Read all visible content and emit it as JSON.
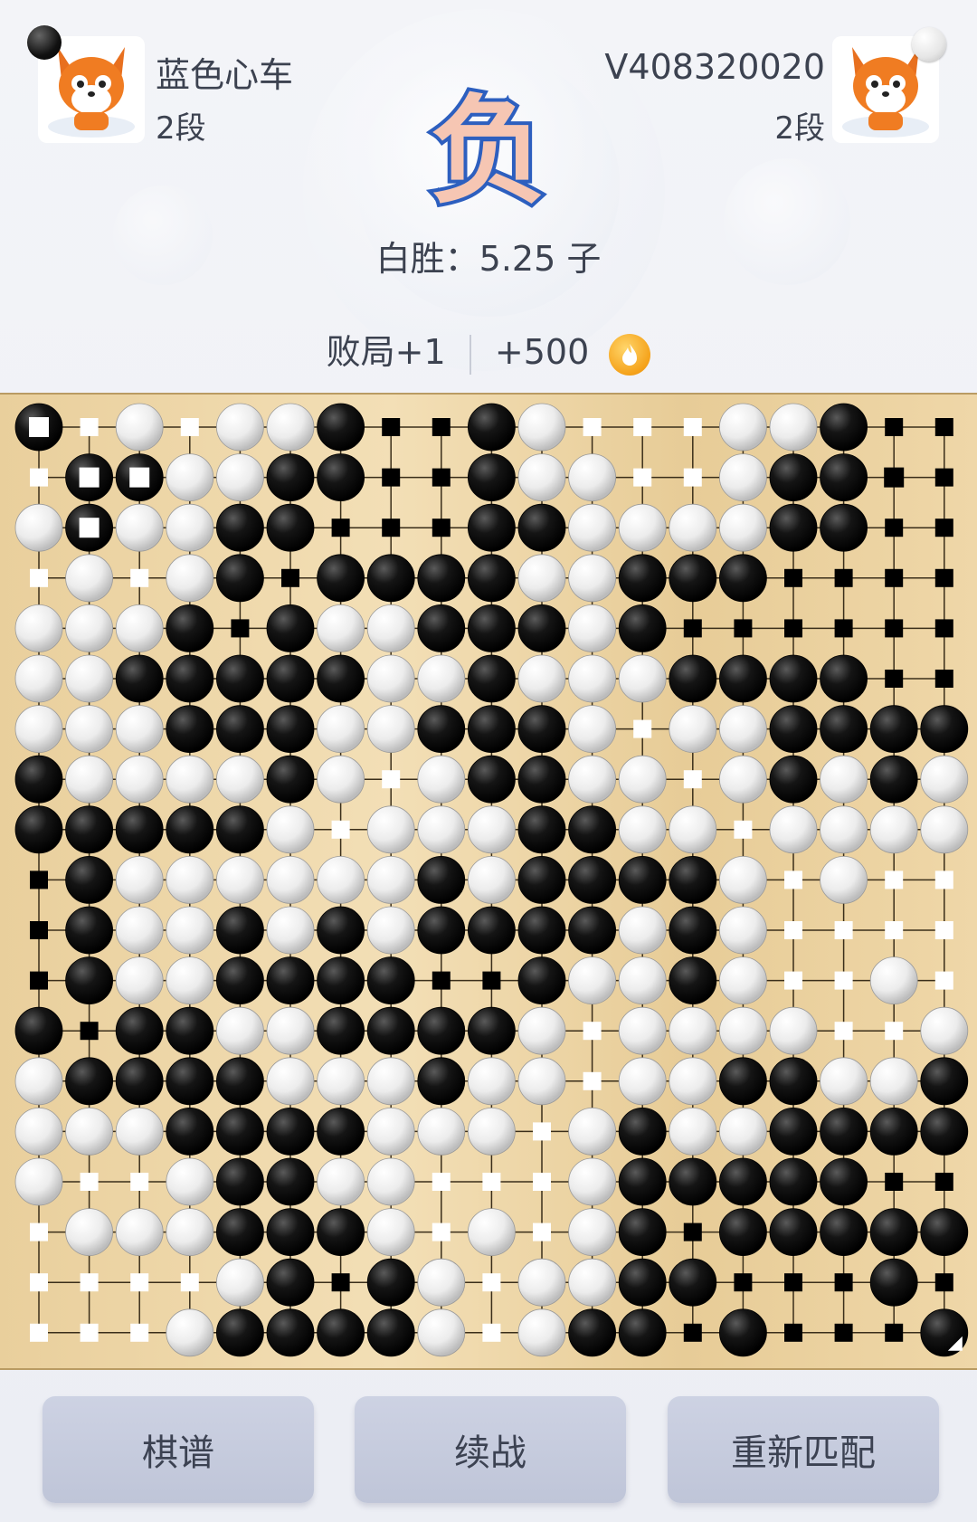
{
  "black_player": {
    "name": "蓝色心车",
    "rank": "2段",
    "stone": "black"
  },
  "white_player": {
    "name": "V408320020",
    "rank": "2段",
    "stone": "white"
  },
  "result": {
    "glyph": "负",
    "text": "白胜：5.25 子",
    "loss_count": "败局+1",
    "reward": "+500",
    "coin_icon": "coin-icon"
  },
  "board": {
    "size": 19,
    "legend": "B=black stone, W=white stone, b=black territory marker, w=white territory marker, .=empty",
    "rows": [
      "BwWwWWBbbBWwwwWWBbb",
      "wBBWWBBbbBWWwwWBBwb",
      "WBWWBBbbbBBWWWWBBbb",
      "wWwWBbBBBBWWBBBbbbb",
      "WWWBbBWWBBBWBbbbbbb",
      "WWBBBBBWWBWWWBBBBbb",
      "WWWBBBWWBBBWwWWBBBB",
      "BWWWWBWwWBBWWwWBWBW",
      "BBBBBWwWWWBBWWwWWWW",
      "bBWWWWWWBWBBBBWwWww",
      "bBWWBWBWBBBBWBWwwww",
      "bBWWBBBBbbBWWBWwwWw",
      "BbBBWWBBBBWwWWWWwwW",
      "WBBBBWWWBWWwWWBBWWB",
      "WWWBBBBWWWwWBWWBBBB",
      "WwwWBBWWwwwWBBBBBbb",
      "wWWWBBBWwWwWBbBBBBB",
      "wwwwWBbBWwWWBBbbbBb",
      "wwwWBBBBWwWBBbBbbbB"
    ]
  },
  "buttons": {
    "record": "棋谱",
    "continue": "续战",
    "rematch": "重新匹配"
  }
}
